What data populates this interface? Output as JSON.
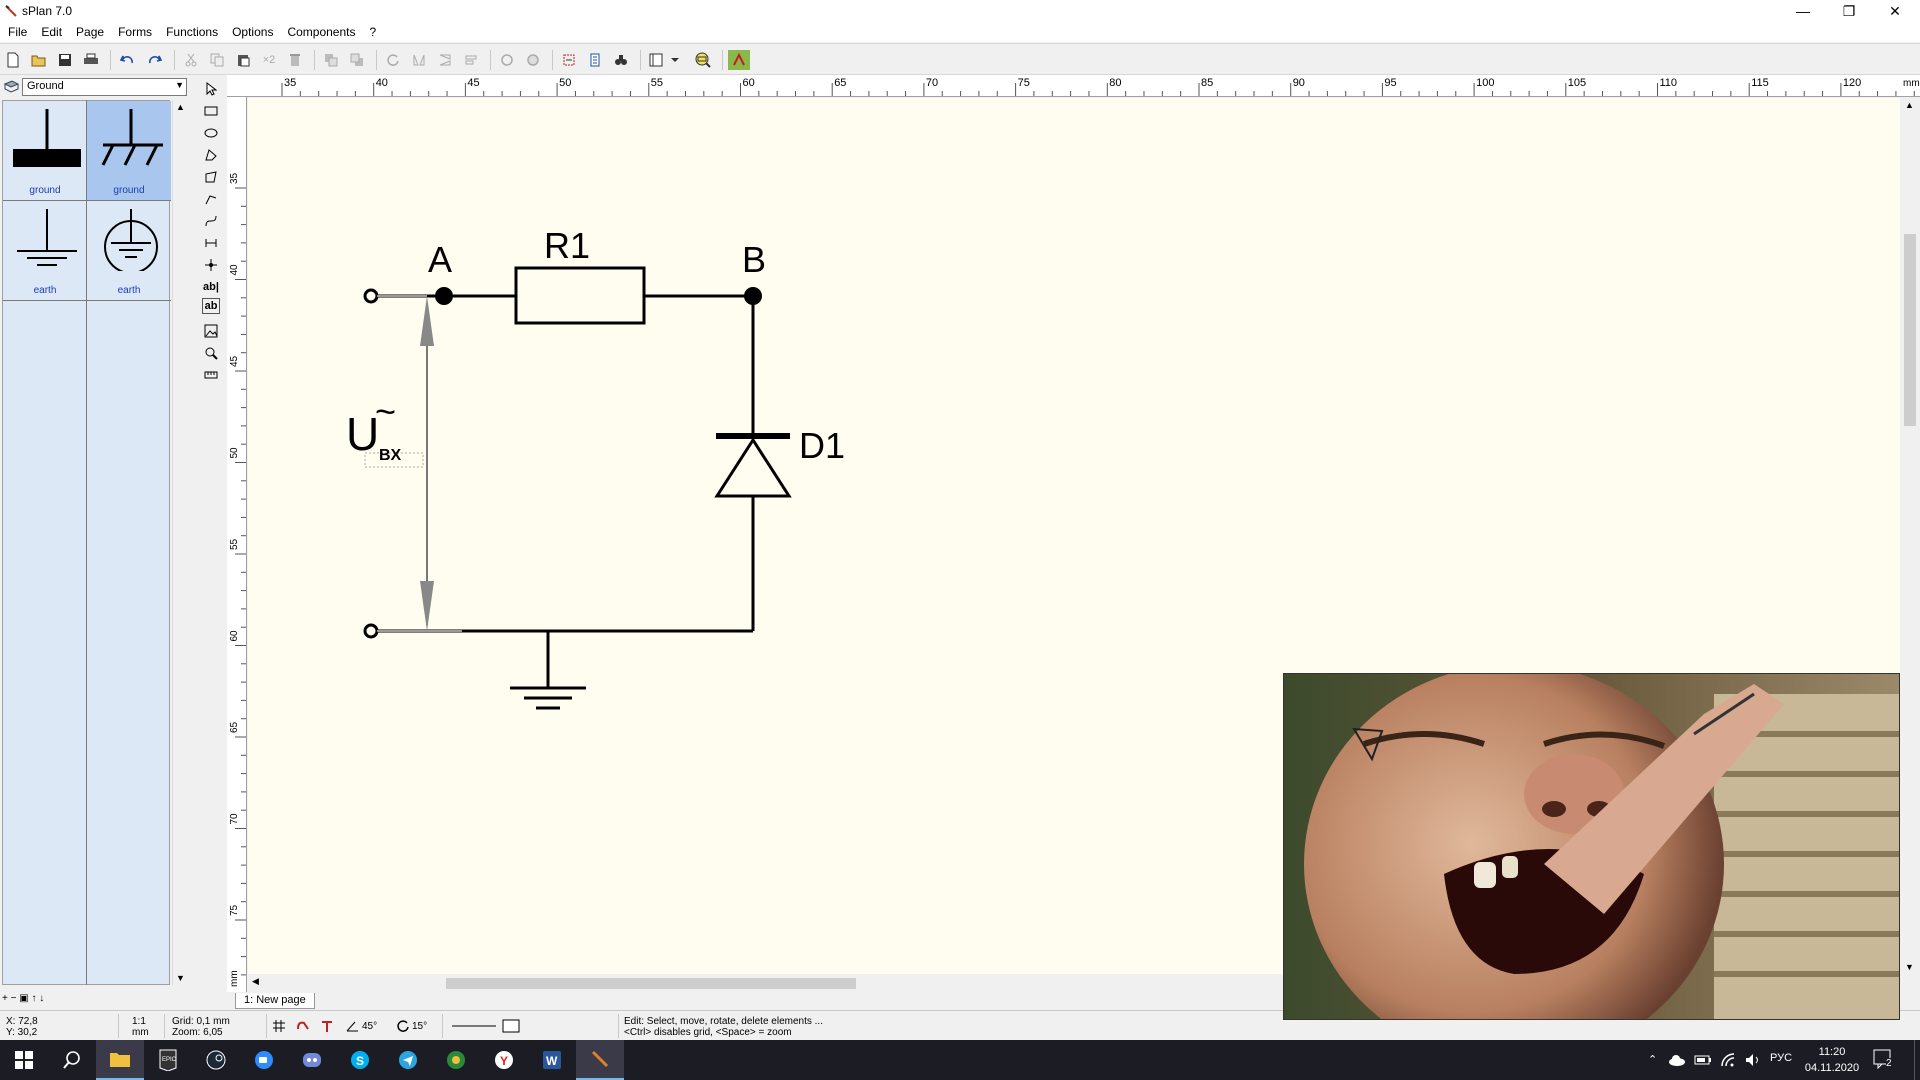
{
  "window": {
    "title": "sPlan 7.0",
    "controls": {
      "minimize": "—",
      "restore": "❐",
      "close": "✕"
    }
  },
  "menu": [
    "File",
    "Edit",
    "Page",
    "Forms",
    "Functions",
    "Options",
    "Components",
    "?"
  ],
  "library": {
    "selected": "Ground",
    "items": [
      {
        "label": "ground",
        "icon": "ground-bar-icon"
      },
      {
        "label": "ground",
        "icon": "chassis-ground-icon"
      },
      {
        "label": "earth",
        "icon": "earth-lines-icon"
      },
      {
        "label": "earth",
        "icon": "earth-circle-icon"
      }
    ],
    "bottom_controls": "+ − ▣ ↑ ↓"
  },
  "tools": [
    "ab|",
    "ab"
  ],
  "ruler": {
    "unit": "mm",
    "h_ticks": [
      "35",
      "40",
      "45",
      "50",
      "55",
      "60",
      "65",
      "70",
      "75",
      "80",
      "85",
      "90",
      "95",
      "100",
      "105",
      "110",
      "115",
      "120"
    ],
    "v_ticks": [
      "35",
      "40",
      "45",
      "50",
      "55",
      "60",
      "65",
      "70",
      "75"
    ]
  },
  "schematic": {
    "node_a": "A",
    "node_b": "B",
    "resistor": "R1",
    "diode": "D1",
    "voltage_main": "U",
    "voltage_tilde": "~",
    "voltage_sub": "BX"
  },
  "page_tab": "1: New page",
  "status": {
    "x": "X: 72,8",
    "y": "Y: 30,2",
    "scale": "1:1",
    "scale_unit": "mm",
    "grid": "Grid:   0,1 mm",
    "zoom": "Zoom:  6,05",
    "angle1": "45°",
    "angle2": "15°",
    "hint1": "Edit: Select, move, rotate, delete elements ...",
    "hint2": "<Ctrl> disables grid, <Space> = zoom"
  },
  "taskbar": {
    "language": "РУС",
    "time": "11:20",
    "date": "04.11.2020",
    "notifications": "2"
  },
  "colors": {
    "canvas_bg": "#fefdf0",
    "library_bg": "#dde8f7",
    "library_selected": "#a9c7ee",
    "taskbar_bg": "#1c1c24"
  }
}
